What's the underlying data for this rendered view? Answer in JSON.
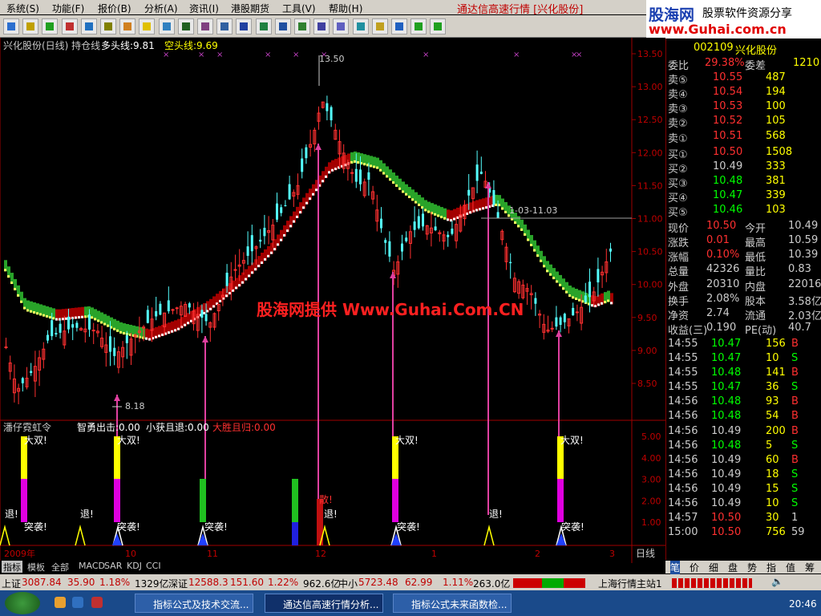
{
  "menu": {
    "items": [
      "系统(S)",
      "功能(F)",
      "报价(B)",
      "分析(A)",
      "资讯(I)",
      "港股期货",
      "工具(V)",
      "帮助(H)"
    ],
    "title": "通达信高速行情 [兴化股份]"
  },
  "logo": {
    "top": "股海网",
    "tagline": "股票软件资源分享",
    "url": "www.Guhai.com.cn"
  },
  "toolbar": {
    "icons": [
      "grid-icon",
      "table-icon",
      "line-chart-icon",
      "volume-icon",
      "list-icon",
      "bars-icon",
      "folder-icon",
      "star-icon",
      "people-icon",
      "board-icon",
      "chart-icon",
      "message-icon",
      "exe-icon",
      "excel-icon",
      "rsi-icon",
      "refresh-icon",
      "chart2-icon",
      "link-icon",
      "enter-icon",
      "pencil-icon",
      "move-icon",
      "up-arrow-icon",
      "down-arrow-icon"
    ]
  },
  "chart": {
    "header": {
      "name": "兴化股份(日线) 持仓线",
      "long_label": "多头线:9.81",
      "short_label": "空头线:9.69"
    },
    "watermark": "股海网提供 Www.Guhai.Com.CN",
    "annotations": {
      "high": "13.50",
      "low": "8.18",
      "level": "1-03-11.03"
    },
    "indicator": {
      "name": "潘仔霓虹令",
      "items": [
        "智勇出击:0.00",
        "小获且退:0.00",
        "大胜且归:0.00"
      ],
      "labels": {
        "big": "大双!",
        "exit": "退!",
        "attack": "突袭!",
        "san": "散!"
      }
    },
    "price_axis": [
      "13.50",
      "13.00",
      "12.50",
      "12.00",
      "11.50",
      "11.00",
      "10.50",
      "10.00",
      "9.50",
      "9.00",
      "8.50"
    ],
    "ind_axis": [
      "5.00",
      "4.00",
      "3.00",
      "2.00",
      "1.00"
    ],
    "x_axis": [
      "2009年",
      "10",
      "11",
      "12",
      "1",
      "2",
      "3"
    ],
    "period": "日线"
  },
  "chart_data": {
    "type": "candlestick",
    "title": "兴化股份(日线)",
    "ylim": [
      8.0,
      13.6
    ],
    "markers": {
      "high": 13.5,
      "low": 8.18
    }
  },
  "quote": {
    "code": "002109",
    "name": "兴化股份",
    "ratio": {
      "label": "委比",
      "value": "29.38%",
      "diff_label": "委差",
      "diff": "1210"
    },
    "sells": [
      {
        "label": "卖⑤",
        "price": "10.55",
        "vol": "487"
      },
      {
        "label": "卖④",
        "price": "10.54",
        "vol": "194"
      },
      {
        "label": "卖③",
        "price": "10.53",
        "vol": "100"
      },
      {
        "label": "卖②",
        "price": "10.52",
        "vol": "105"
      },
      {
        "label": "卖①",
        "price": "10.51",
        "vol": "568"
      }
    ],
    "buys": [
      {
        "label": "买①",
        "price": "10.50",
        "vol": "1508"
      },
      {
        "label": "买②",
        "price": "10.49",
        "vol": "333"
      },
      {
        "label": "买③",
        "price": "10.48",
        "vol": "381"
      },
      {
        "label": "买④",
        "price": "10.47",
        "vol": "339"
      },
      {
        "label": "买⑤",
        "price": "10.46",
        "vol": "103"
      }
    ],
    "stats": [
      {
        "l1": "现价",
        "v1": "10.50",
        "l2": "今开",
        "v2": "10.49"
      },
      {
        "l1": "涨跌",
        "v1": "0.01",
        "l2": "最高",
        "v2": "10.59"
      },
      {
        "l1": "涨幅",
        "v1": "0.10%",
        "l2": "最低",
        "v2": "10.39"
      },
      {
        "l1": "总量",
        "v1": "42326",
        "l2": "量比",
        "v2": "0.83"
      },
      {
        "l1": "外盘",
        "v1": "20310",
        "l2": "内盘",
        "v2": "22016"
      },
      {
        "l1": "换手",
        "v1": "2.08%",
        "l2": "股本",
        "v2": "3.58亿"
      },
      {
        "l1": "净资",
        "v1": "2.74",
        "l2": "流通",
        "v2": "2.03亿"
      },
      {
        "l1": "收益(三)",
        "v1": "0.190",
        "l2": "PE(动)",
        "v2": "40.7"
      }
    ],
    "ticks": [
      {
        "t": "14:55",
        "p": "10.47",
        "v": "156",
        "s": "B"
      },
      {
        "t": "14:55",
        "p": "10.47",
        "v": "10",
        "s": "S"
      },
      {
        "t": "14:55",
        "p": "10.48",
        "v": "141",
        "s": "B"
      },
      {
        "t": "14:55",
        "p": "10.47",
        "v": "36",
        "s": "S"
      },
      {
        "t": "14:56",
        "p": "10.48",
        "v": "93",
        "s": "B"
      },
      {
        "t": "14:56",
        "p": "10.48",
        "v": "54",
        "s": "B"
      },
      {
        "t": "14:56",
        "p": "10.49",
        "v": "200",
        "s": "B"
      },
      {
        "t": "14:56",
        "p": "10.48",
        "v": "5",
        "s": "S"
      },
      {
        "t": "14:56",
        "p": "10.49",
        "v": "60",
        "s": "B"
      },
      {
        "t": "14:56",
        "p": "10.49",
        "v": "18",
        "s": "S"
      },
      {
        "t": "14:56",
        "p": "10.49",
        "v": "15",
        "s": "S"
      },
      {
        "t": "14:56",
        "p": "10.49",
        "v": "10",
        "s": "S"
      },
      {
        "t": "14:57",
        "p": "10.50",
        "v": "30",
        "s": "1"
      },
      {
        "t": "15:00",
        "p": "10.50",
        "v": "756",
        "s": "59"
      }
    ]
  },
  "tabs": [
    "指标",
    "模板",
    "全部",
    "MACD",
    "SAR",
    "KDJ",
    "CCI"
  ],
  "rtabs": [
    "笔",
    "价",
    "细",
    "盘",
    "势",
    "指",
    "值",
    "筹"
  ],
  "status": {
    "sh": "上证",
    "sh_val": "3087.84",
    "sh_chg": "35.90",
    "sh_pct": "1.18%",
    "sh_amt": "1329亿",
    "sz": "深证",
    "sz_val": "12588.3",
    "sz_chg": "151.60",
    "sz_pct": "1.22%",
    "sz_amt": "962.6亿",
    "zx": "中小",
    "zx_val": "5723.48",
    "zx_chg": "62.99",
    "zx_pct": "1.11%",
    "zx_amt": "263.0亿",
    "station": "上海行情主站1"
  },
  "taskbar": {
    "items": [
      "指标公式及技术交流...",
      "通达信高速行情分析...",
      "指标公式未来函数检..."
    ],
    "clock": "20:46"
  }
}
